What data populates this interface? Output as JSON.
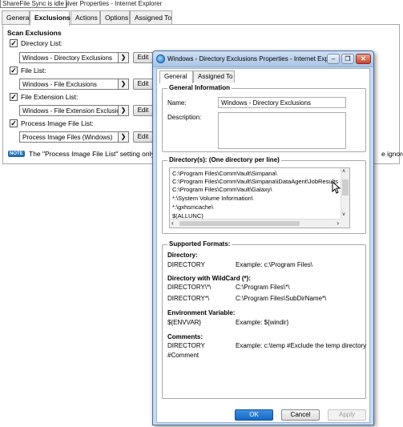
{
  "background_window": {
    "tooltip": "ShareFile Sync is idle",
    "title_rest": "hiver Properties - Internet Explorer",
    "tabs": [
      "General",
      "Exclusions",
      "Actions",
      "Options",
      "Assigned To"
    ],
    "active_tab": "Exclusions",
    "group_title": "Scan Exclusions",
    "rows": [
      {
        "label": "Directory List:",
        "value": "Windows - Directory Exclusions",
        "edit": "Edit"
      },
      {
        "label": "File List:",
        "value": "Windows - File Exclusions",
        "edit": "Edit"
      },
      {
        "label": "File Extension List:",
        "value": "Windows - File Extension Exclusions",
        "edit": "Edit"
      },
      {
        "label": "Process Image File List:",
        "value": "Process Image Files (Windows)",
        "edit": "Edit"
      }
    ],
    "note_badge": "NOTE",
    "note_text": "The \"Process Image File List\" setting only ap",
    "note_tail": "e ignored"
  },
  "dialog": {
    "title": "Windows - Directory Exclusions Properties - Internet Explorer",
    "caption_buttons": {
      "minimize": "–",
      "restore": "❐",
      "close": "✕"
    },
    "tabs": [
      "General",
      "Assigned To"
    ],
    "active_tab": "General",
    "general_info": {
      "legend": "General Information",
      "name_label": "Name:",
      "name_value": "Windows - Directory Exclusions",
      "description_label": "Description:",
      "description_value": ""
    },
    "directories": {
      "legend": "Directory(s): (One directory per line)",
      "lines": [
        "C:\\Program Files\\CommVault\\Simpana\\",
        "C:\\Program Files\\CommVault\\Simpana\\iDataAgent\\JobResults",
        "C:\\Program Files\\CommVault\\Galaxy\\",
        "*:\\System Volume Information\\",
        "*:\\gxhsmcache\\",
        "$(ALLUNC)"
      ]
    },
    "formats": {
      "legend": "Supported Formats:",
      "sections": [
        {
          "heading": "Directory:",
          "rows": [
            [
              "DIRECTORY",
              "Example: c:\\Program Files\\"
            ]
          ]
        },
        {
          "heading": "Directory with WildCard (*):",
          "rows": [
            [
              "DIRECTORY\\*\\",
              "C:\\Program Files\\*\\"
            ],
            [
              "DIRECTORY*\\",
              "C:\\Program Files\\SubDirName*\\"
            ]
          ]
        },
        {
          "heading": "Environment Variable:",
          "rows": [
            [
              "${ENVVAR}",
              "Example: ${windir}"
            ]
          ]
        },
        {
          "heading": "Comments:",
          "rows": [
            [
              "DIRECTORY",
              "Example: c:\\temp #Exclude the temp directory"
            ],
            [
              "#Comment",
              ""
            ]
          ]
        }
      ]
    },
    "buttons": {
      "ok": "OK",
      "cancel": "Cancel",
      "apply": "Apply"
    }
  }
}
